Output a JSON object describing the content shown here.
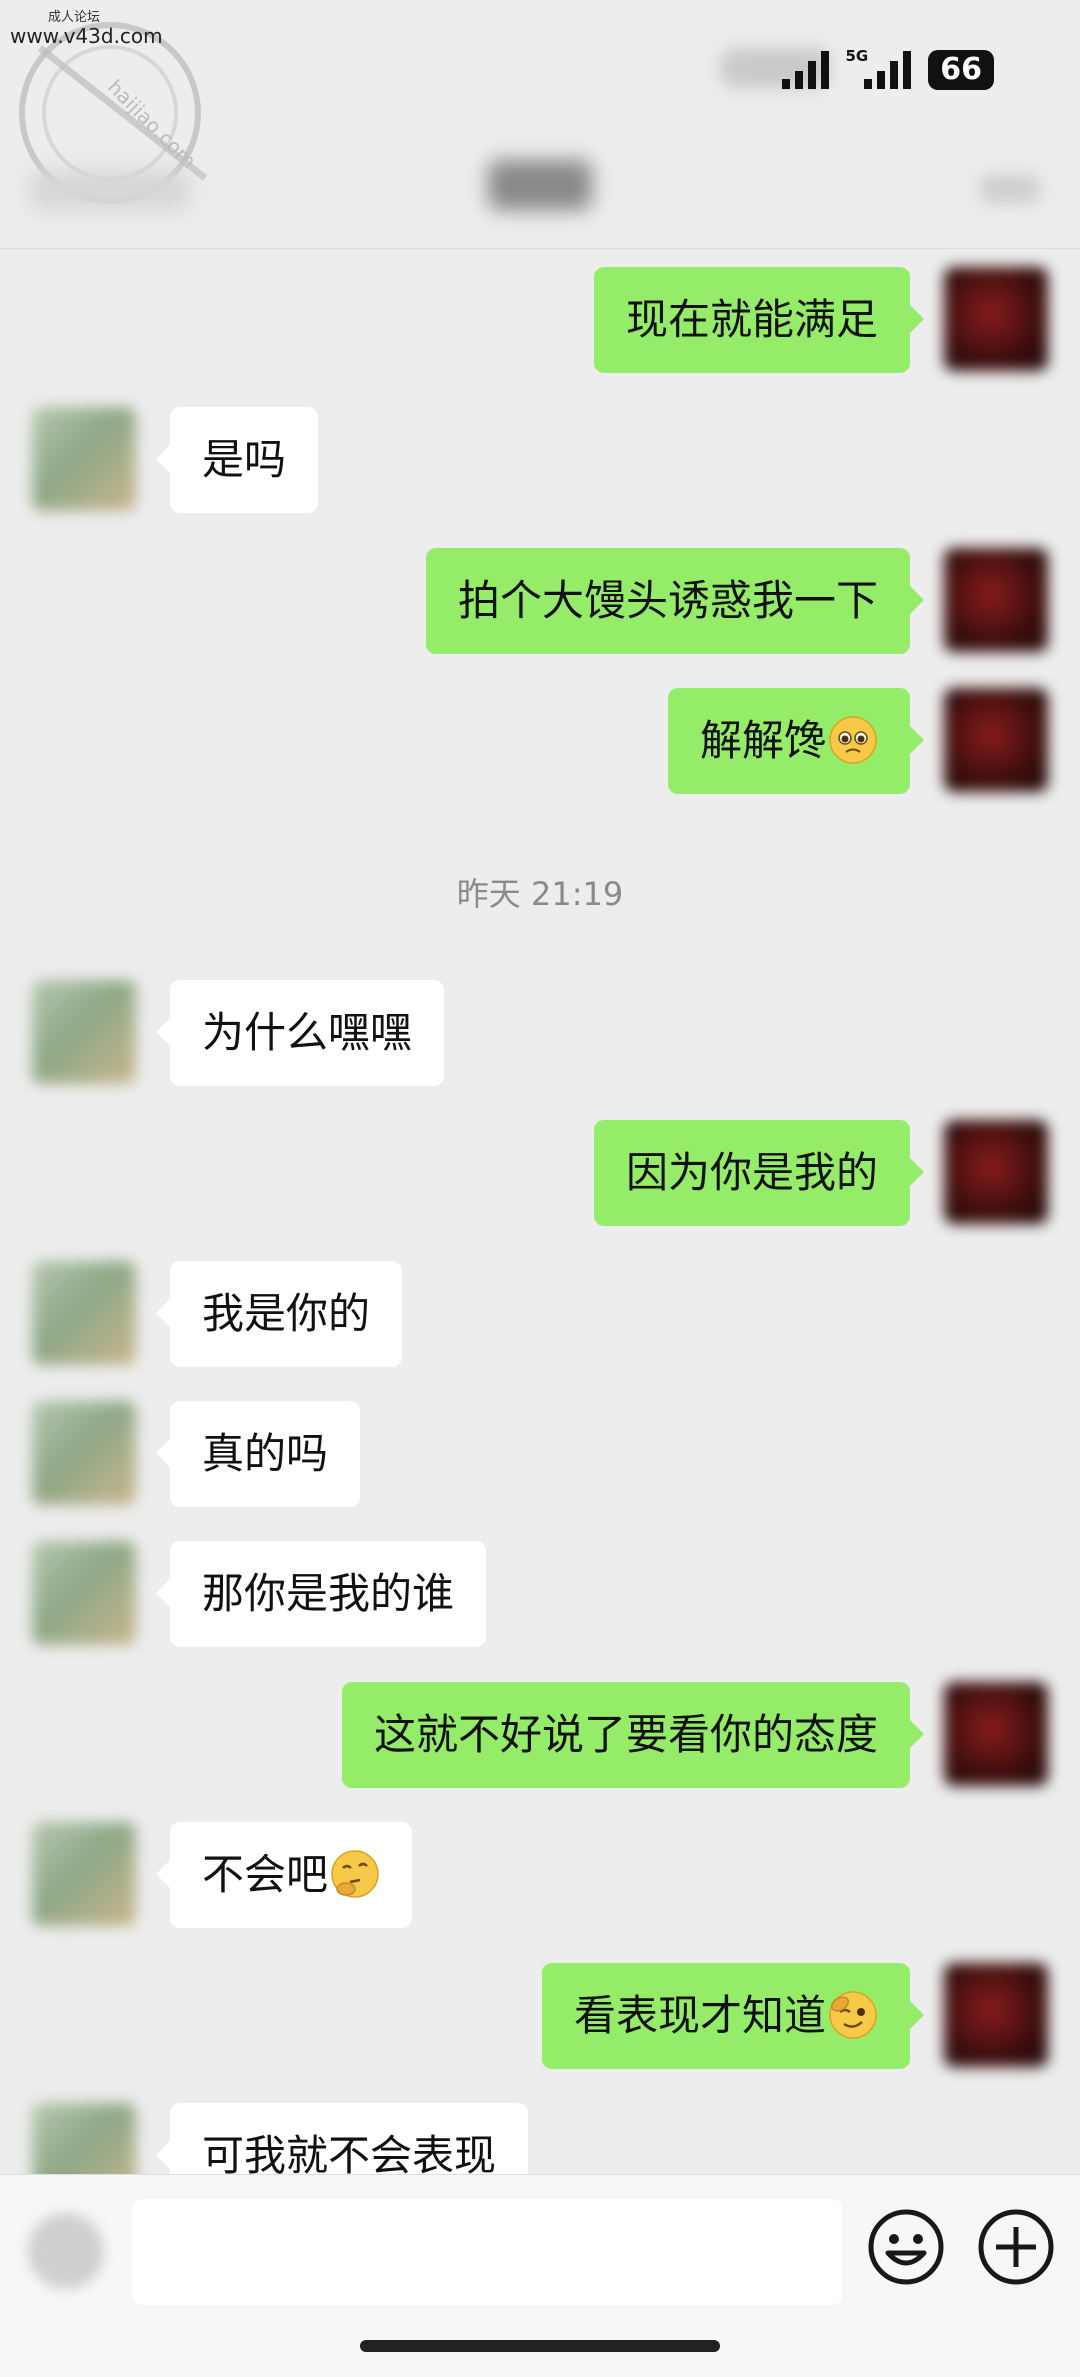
{
  "watermark": {
    "top_text": "成人论坛",
    "url": "www.v43d.com",
    "stamp_text": "海角社区 haijiao.com"
  },
  "status_bar": {
    "network": "5G",
    "battery": "66"
  },
  "nav": {
    "title": "",
    "back_label": ""
  },
  "messages": [
    {
      "side": "right",
      "text": "现在就能满足"
    },
    {
      "side": "left",
      "text": "是吗"
    },
    {
      "side": "right",
      "text": "拍个大馒头诱惑我一下"
    },
    {
      "side": "right",
      "text": "解解馋",
      "emoji": "pleading-face-icon"
    },
    {
      "type": "timestamp",
      "text": "昨天 21:19"
    },
    {
      "side": "left",
      "text": "为什么嘿嘿"
    },
    {
      "side": "right",
      "text": "因为你是我的"
    },
    {
      "side": "left",
      "text": "我是你的"
    },
    {
      "side": "left",
      "text": "真的吗"
    },
    {
      "side": "left",
      "text": "那你是我的谁"
    },
    {
      "side": "right",
      "text": "这就不好说了要看你的态度"
    },
    {
      "side": "left",
      "text": "不会吧",
      "emoji": "thinking-face-icon"
    },
    {
      "side": "right",
      "text": "看表现才知道",
      "emoji": "winking-face-icon"
    },
    {
      "side": "left",
      "text": "可我就不会表现"
    }
  ],
  "input": {
    "value": "",
    "placeholder": ""
  },
  "colors": {
    "background": "#ededed",
    "outgoing_bubble": "#95ec69",
    "incoming_bubble": "#ffffff",
    "timestamp": "#8a8a8a"
  }
}
